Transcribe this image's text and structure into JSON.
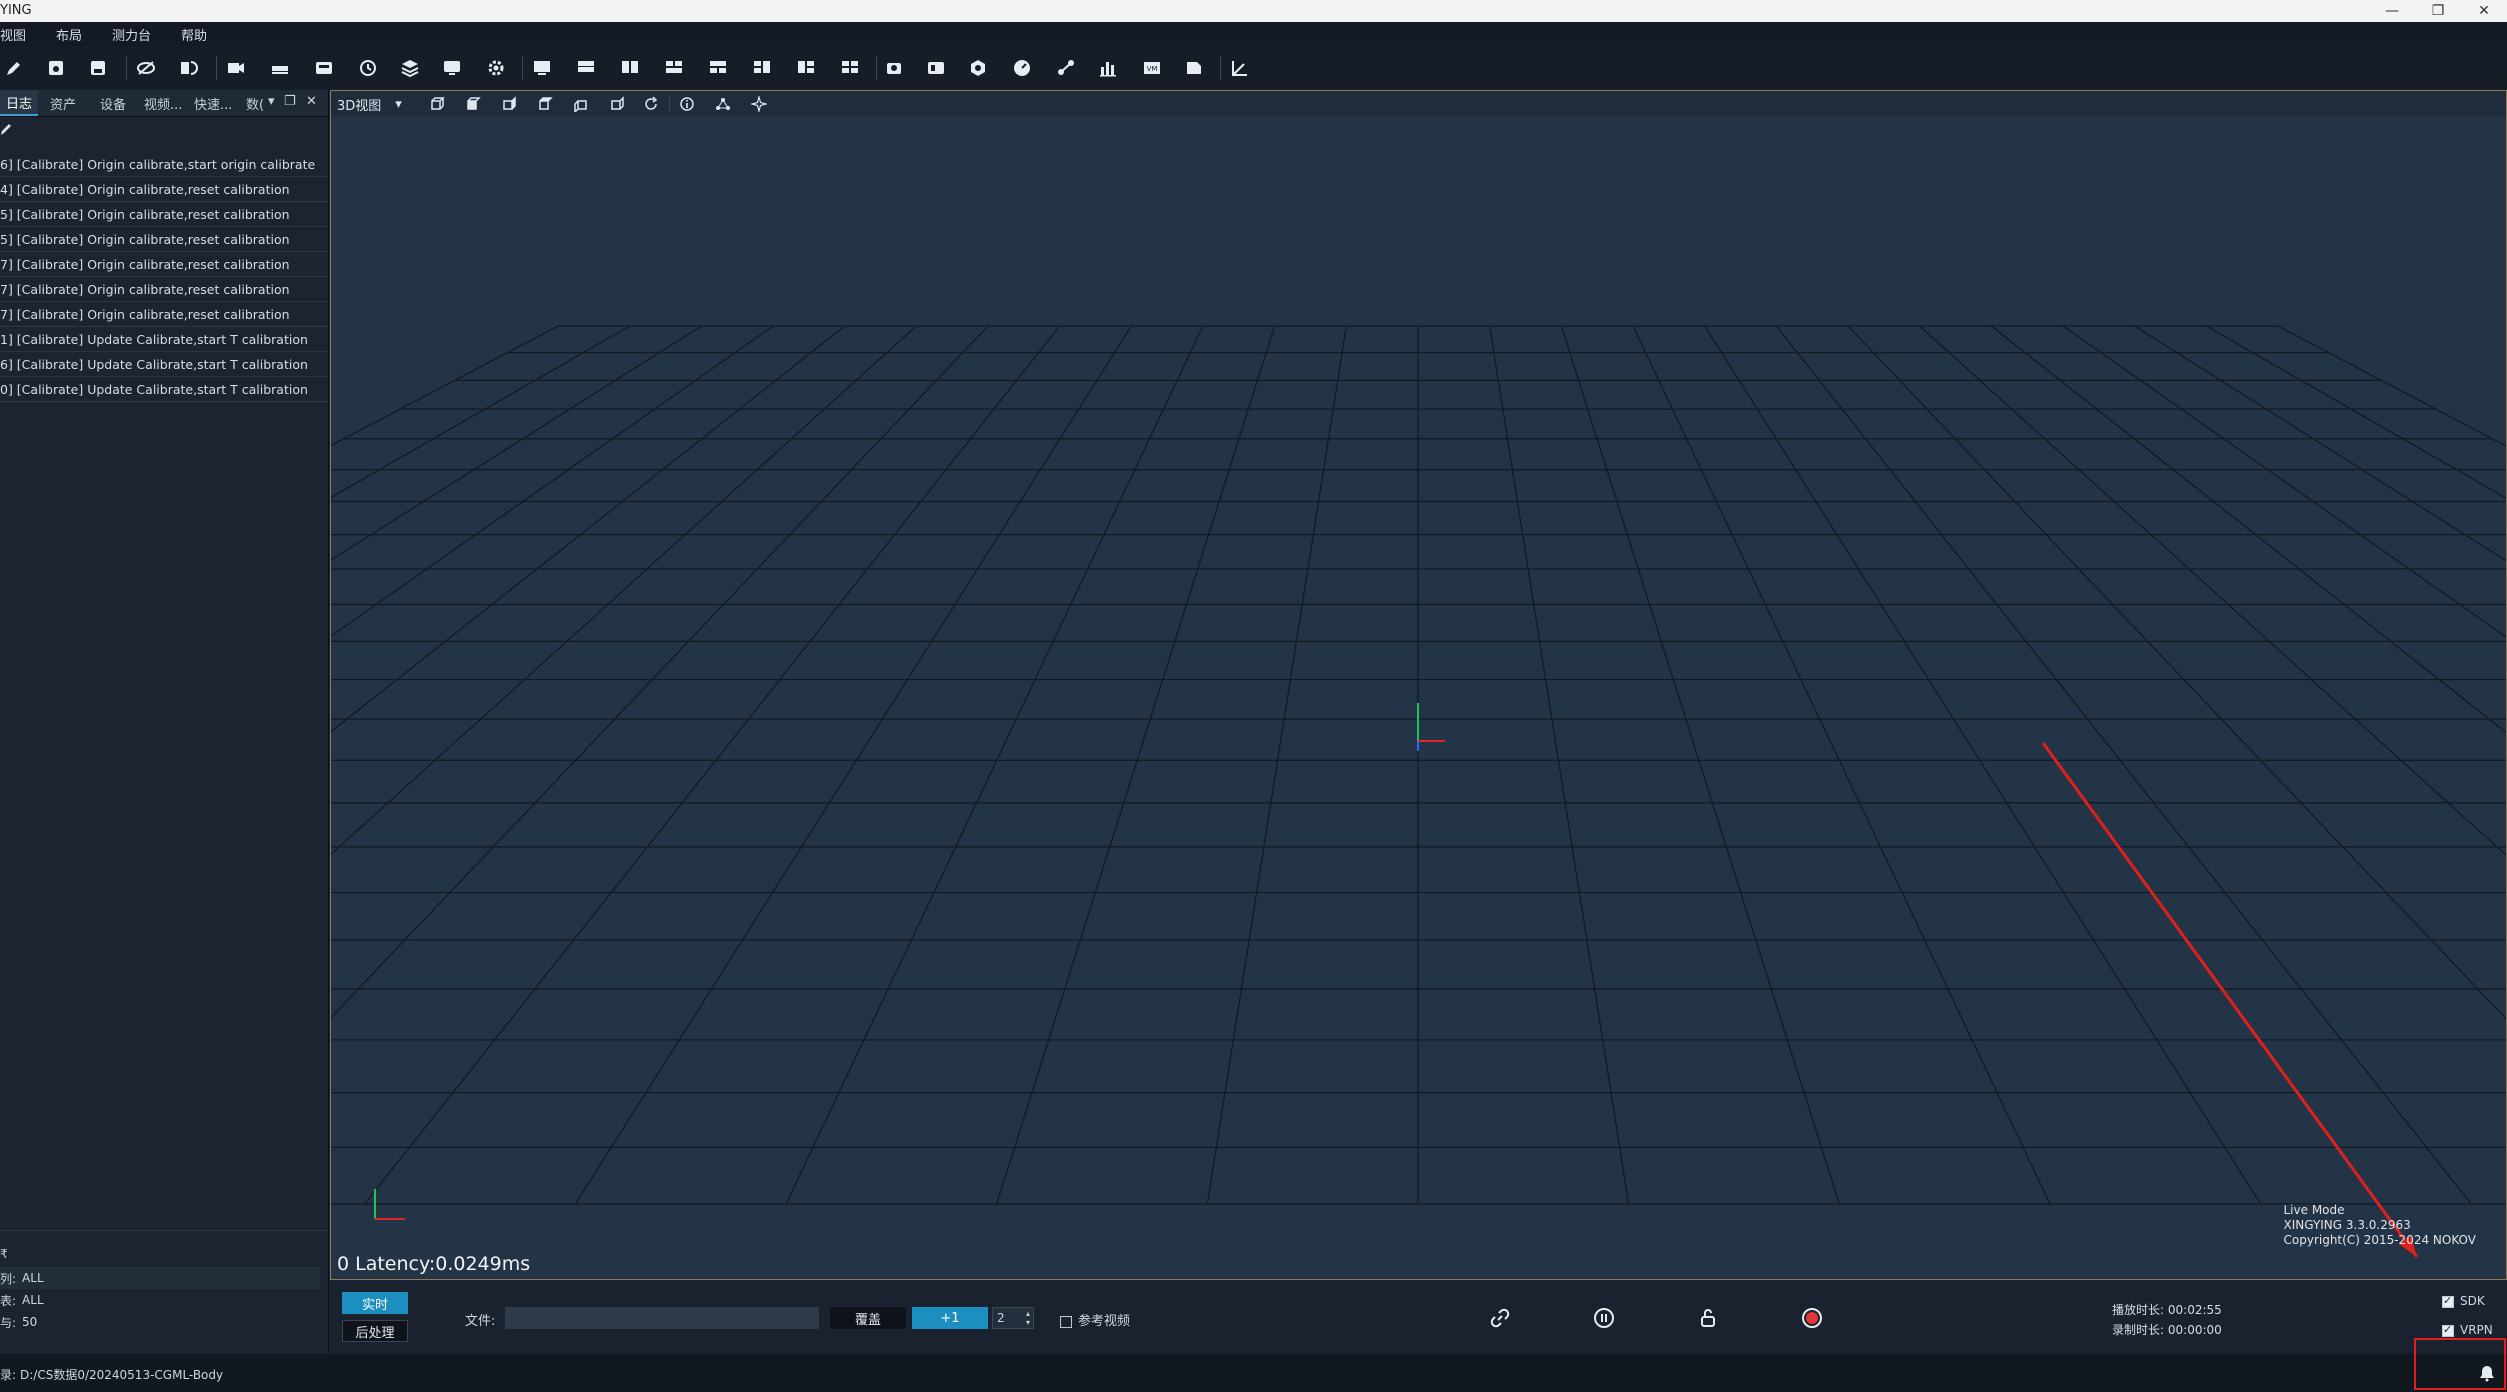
{
  "window": {
    "title": "YING",
    "controls": [
      "—",
      "❐",
      "✕"
    ]
  },
  "menu": [
    "视图",
    "布局",
    "测力台",
    "帮助"
  ],
  "left_panel": {
    "tabs": [
      "日志",
      "资产",
      "设备",
      "视频...",
      "快速...",
      "数("
    ],
    "logs": [
      "6] [Calibrate] Origin calibrate,start origin calibrate",
      "4] [Calibrate] Origin calibrate,reset calibration",
      "5] [Calibrate] Origin calibrate,reset calibration",
      "5] [Calibrate] Origin calibrate,reset calibration",
      "7] [Calibrate] Origin calibrate,reset calibration",
      "7] [Calibrate] Origin calibrate,reset calibration",
      "7] [Calibrate] Origin calibrate,reset calibration",
      "1] [Calibrate] Update Calibrate,start T calibration",
      "6] [Calibrate] Update Calibrate,start T calibration",
      "0] [Calibrate] Update Calibrate,start T calibration"
    ],
    "bottom": {
      "header": "₹",
      "rows": [
        {
          "label": "列:",
          "value": "ALL"
        },
        {
          "label": "表:",
          "value": "ALL"
        },
        {
          "label": "与:",
          "value": "50"
        }
      ]
    }
  },
  "viewport": {
    "view_select": "3D视图",
    "latency": "0 Latency:0.0249ms",
    "info": {
      "mode": "Live Mode",
      "version": "XINGYING 3.3.0.2963",
      "copyright": "Copyright(C) 2015-2024 NOKOV"
    }
  },
  "controls": {
    "live_label": "实时",
    "post_label": "后处理",
    "file_label": "文件:",
    "overwrite_label": "覆盖",
    "plus_label": "+1",
    "spin_value": "2",
    "ref_video_label": "参考视频",
    "play_time_label": "播放时长:",
    "play_time": "00:02:55",
    "rec_time_label": "录制时长:",
    "rec_time": "00:00:00",
    "sdk_label": "SDK",
    "vrpn_label": "VRPN"
  },
  "status": {
    "path_label": "录:",
    "path": "D:/CS数据0/20240513-CGML-Body"
  },
  "colors": {
    "accent": "#1b8fc0",
    "annotation_red": "#e0201b"
  }
}
